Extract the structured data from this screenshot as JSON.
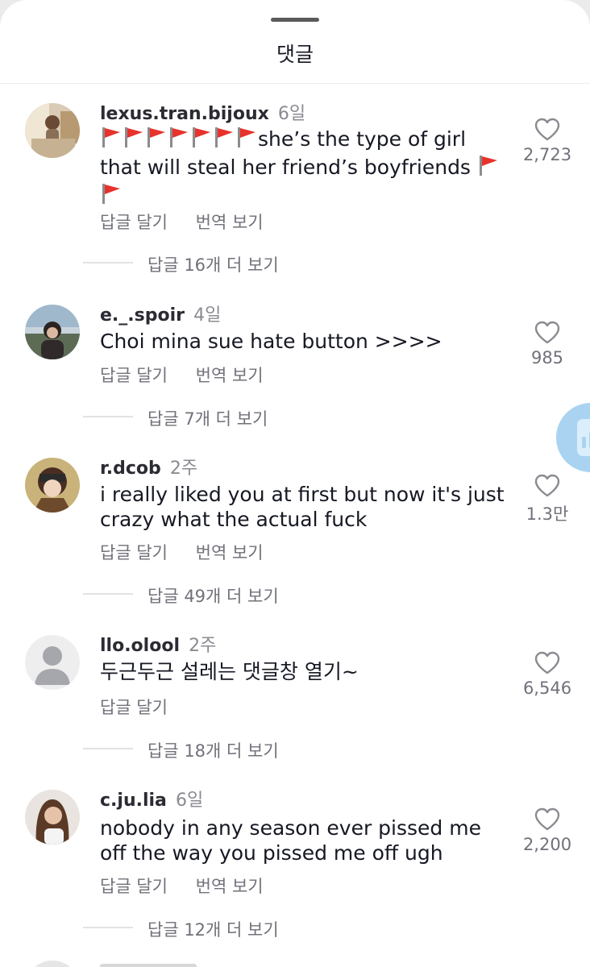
{
  "header": {
    "title": "댓글"
  },
  "labels": {
    "reply": "답글 달기",
    "translate": "번역 보기"
  },
  "comments": [
    {
      "username": "lexus.tran.bijoux",
      "time": "6일",
      "text_after_flags": "she’s the type of girl that will steal her friend’s boyfriends",
      "flag_emoji": "🚩",
      "likes": "2,723",
      "replies": "답글 16개 더 보기",
      "avatar": "photo-avatar"
    },
    {
      "username": "e._.spoir",
      "time": "4일",
      "text": "Choi mina sue hate button >>>>",
      "likes": "985",
      "replies": "답글 7개 더 보기",
      "avatar": "photo-avatar"
    },
    {
      "username": "r.dcob",
      "time": "2주",
      "text": "i really liked you at first but now it's just crazy what the actual fuck",
      "likes": "1.3만",
      "replies": "답글 49개 더 보기",
      "avatar": "anime-avatar"
    },
    {
      "username": "llo.olool",
      "time": "2주",
      "text": "두근두근 설레는 댓글창 열기~",
      "likes": "6,546",
      "replies": "답글 18개 더 보기",
      "avatar": "default-avatar"
    },
    {
      "username": "c.ju.lia",
      "time": "6일",
      "text": "nobody in any season ever pissed me off the way you pissed me off ugh",
      "likes": "2,200",
      "replies": "답글 12개 더 보기",
      "avatar": "photo-avatar"
    }
  ],
  "colors": {
    "text": "#161823",
    "secondary": "#70717a",
    "side_button": "#a9d3f1"
  }
}
